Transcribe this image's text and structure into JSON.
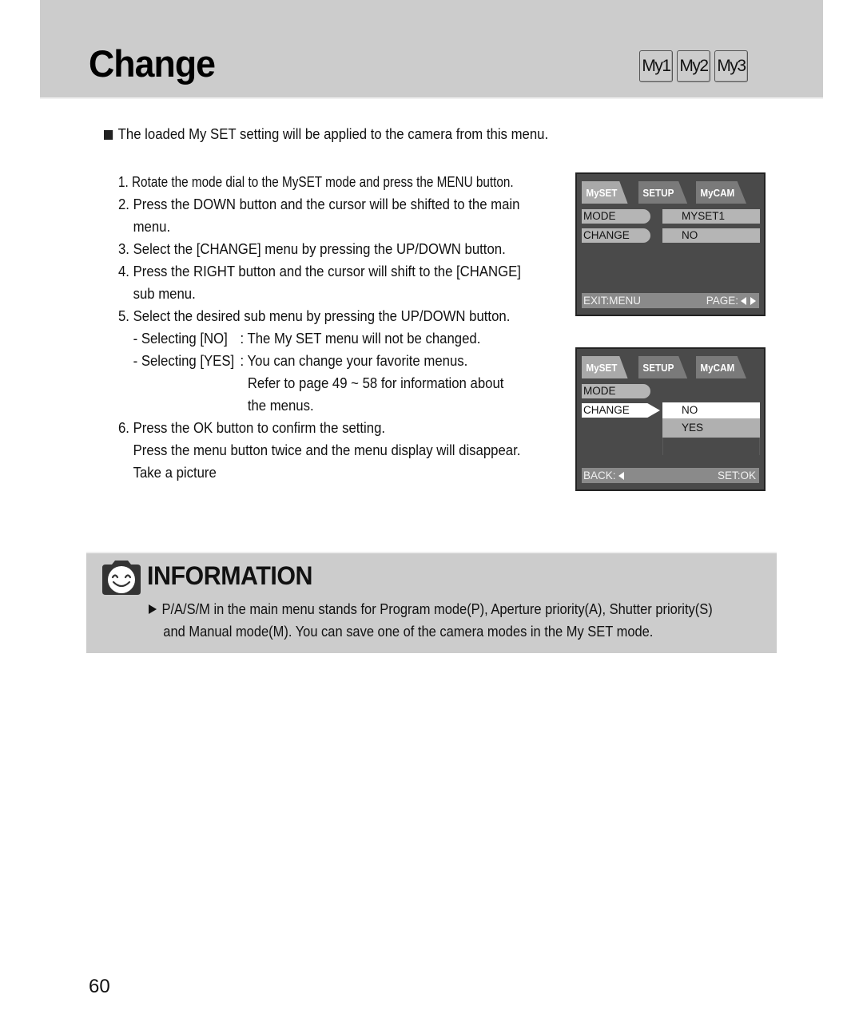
{
  "header": {
    "title": "Change",
    "mode_buttons": [
      "My1",
      "My2",
      "My3"
    ]
  },
  "intro": "The loaded My SET setting will be applied to the camera from this menu.",
  "steps": {
    "s1": "1. Rotate the mode dial to the MySET mode and press the MENU button.",
    "s2a": "2. Press the DOWN button and the cursor will be shifted to the main",
    "s2b": "menu.",
    "s3": "3. Select the [CHANGE] menu by pressing the UP/DOWN button.",
    "s4a": "4. Press the RIGHT button and the cursor will shift to the [CHANGE]",
    "s4b": "sub menu.",
    "s5": "5. Select the desired sub menu by pressing the UP/DOWN button.",
    "no_label": "- Selecting [NO]",
    "no_desc": ": The My SET menu will not be changed.",
    "yes_label": "- Selecting [YES]",
    "yes_desc": ": You can change your favorite menus.",
    "yes_cont1": "Refer to page 49 ~ 58 for information about",
    "yes_cont2": "the menus.",
    "s6": "6. Press the OK button to confirm the setting.",
    "s6b": "Press the menu button twice and the menu display will disappear.",
    "s6c": "Take a picture"
  },
  "screen1": {
    "tabs": [
      "MySET",
      "SETUP",
      "MyCAM"
    ],
    "items": [
      "MODE",
      "CHANGE"
    ],
    "values": [
      "MYSET1",
      "NO"
    ],
    "footer_left": "EXIT:MENU",
    "footer_right": "PAGE:"
  },
  "screen2": {
    "tabs": [
      "MySET",
      "SETUP",
      "MyCAM"
    ],
    "items": [
      "MODE",
      "CHANGE"
    ],
    "options": [
      "NO",
      "YES"
    ],
    "selected_option": "NO",
    "footer_left": "BACK:",
    "footer_right": "SET:OK"
  },
  "information": {
    "title": "INFORMATION",
    "line1": "P/A/S/M in the main menu stands for Program mode(P), Aperture priority(A), Shutter priority(S)",
    "line2": "and Manual mode(M). You can save one of the camera modes in the My SET mode."
  },
  "page_number": "60"
}
